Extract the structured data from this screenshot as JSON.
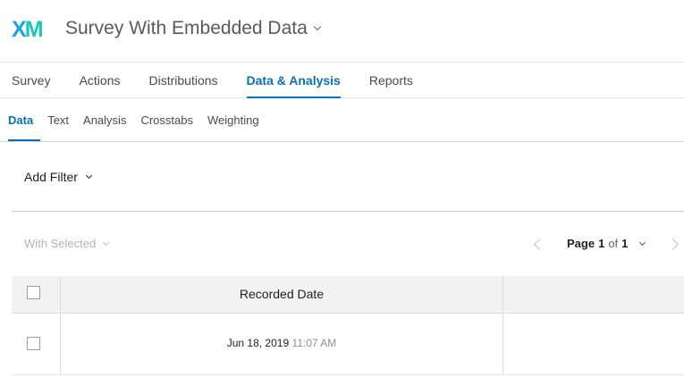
{
  "header": {
    "logo_x": "X",
    "logo_m": "M",
    "survey_title": "Survey With Embedded Data"
  },
  "main_nav": {
    "tabs": [
      {
        "label": "Survey",
        "active": false
      },
      {
        "label": "Actions",
        "active": false
      },
      {
        "label": "Distributions",
        "active": false
      },
      {
        "label": "Data & Analysis",
        "active": true
      },
      {
        "label": "Reports",
        "active": false
      }
    ]
  },
  "sub_nav": {
    "tabs": [
      {
        "label": "Data",
        "active": true
      },
      {
        "label": "Text",
        "active": false
      },
      {
        "label": "Analysis",
        "active": false
      },
      {
        "label": "Crosstabs",
        "active": false
      },
      {
        "label": "Weighting",
        "active": false
      }
    ]
  },
  "filter": {
    "add_filter_label": "Add Filter"
  },
  "toolbar": {
    "with_selected_label": "With Selected",
    "page_word": "Page",
    "current_page": "1",
    "of_word": "of",
    "total_pages": "1"
  },
  "table": {
    "columns": [
      {
        "label": ""
      },
      {
        "label": "Recorded Date"
      },
      {
        "label": ""
      }
    ],
    "rows": [
      {
        "date": "Jun 18, 2019",
        "time": "11:07 AM"
      }
    ]
  },
  "colors": {
    "accent": "#0b6fb5",
    "logo_x": "#1aa3e8",
    "logo_m": "#17c7b7"
  }
}
